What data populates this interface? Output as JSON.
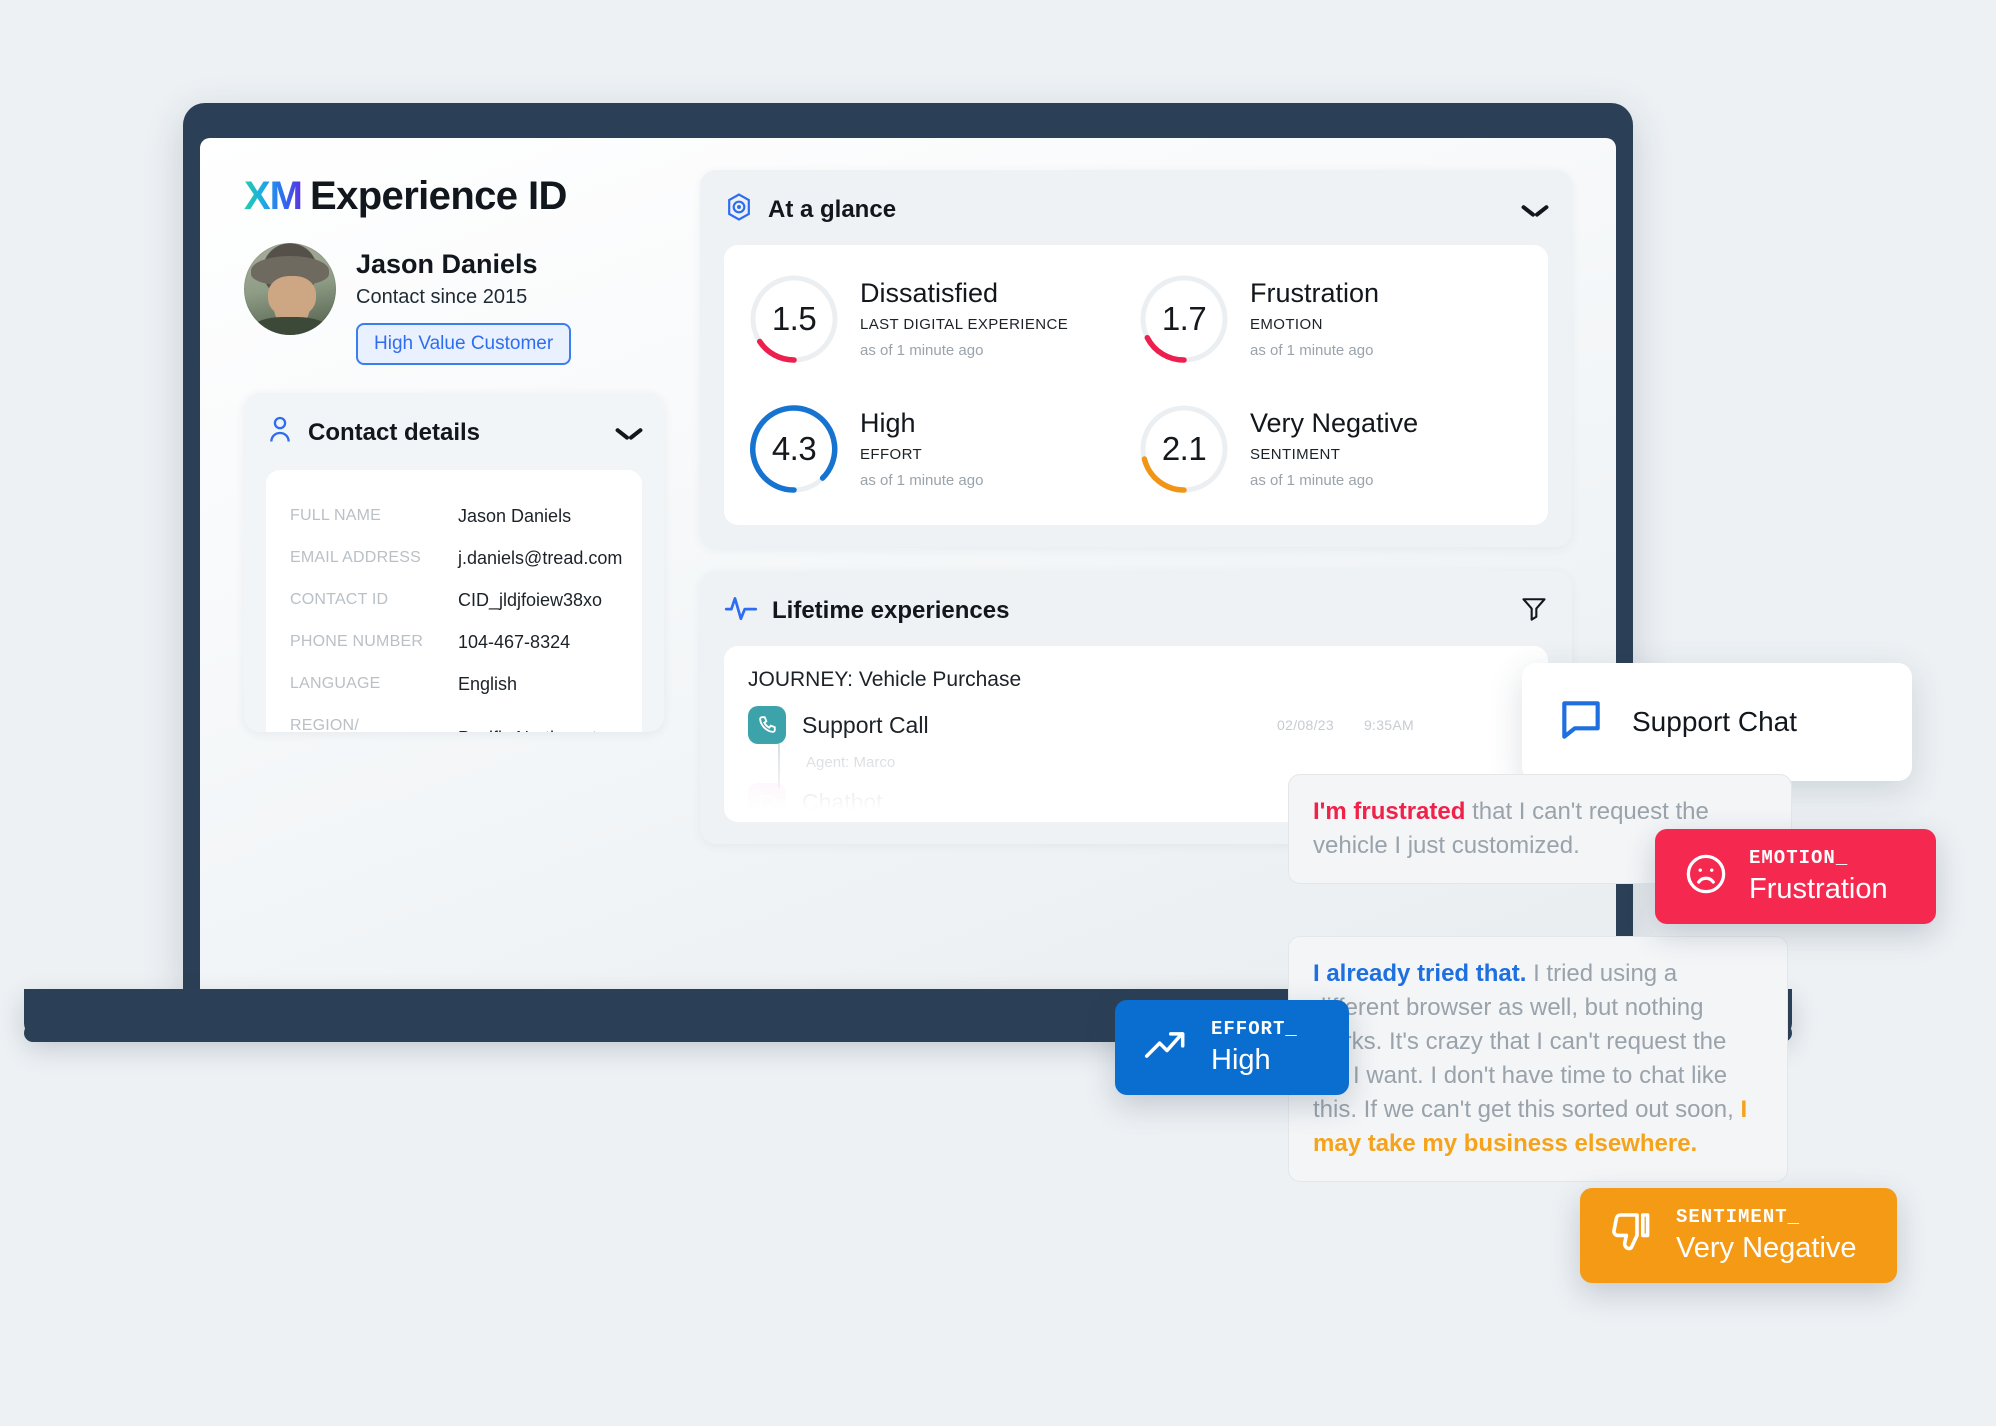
{
  "brand": {
    "mark": "XM",
    "title": "Experience ID"
  },
  "person": {
    "name": "Jason Daniels",
    "since": "Contact since 2015",
    "tag": "High Value Customer",
    "avatar_icon": "user-photo"
  },
  "contact_details": {
    "title": "Contact details",
    "icon": "person-icon",
    "chevron_icon": "chevron-down-icon",
    "rows": [
      {
        "label": "FULL NAME",
        "value": "Jason Daniels"
      },
      {
        "label": "EMAIL ADDRESS",
        "value": "j.daniels@tread.com"
      },
      {
        "label": "CONTACT ID",
        "value": "CID_jldjfoiew38xo"
      },
      {
        "label": "PHONE NUMBER",
        "value": "104-467-8324"
      },
      {
        "label": "LANGUAGE",
        "value": "English"
      },
      {
        "label": "REGION/\nGEOLOCATION",
        "value": "Pacific Northwest, USA"
      }
    ]
  },
  "at_a_glance": {
    "title": "At a glance",
    "icon": "eye-target-icon",
    "chevron_icon": "chevron-down-icon",
    "metrics": [
      {
        "value": "1.5",
        "label": "Dissatisfied",
        "sub": "LAST DIGITAL EXPERIENCE",
        "time": "as of 1 minute ago",
        "color": "#ec1f4e",
        "pct": 30,
        "max": 5
      },
      {
        "value": "1.7",
        "label": "Frustration",
        "sub": "EMOTION",
        "time": "as of 1 minute ago",
        "color": "#ec1f4e",
        "pct": 34,
        "max": 5
      },
      {
        "value": "4.3",
        "label": "High",
        "sub": "EFFORT",
        "time": "as of 1 minute ago",
        "color": "#1673d0",
        "pct": 86,
        "max": 5
      },
      {
        "value": "2.1",
        "label": "Very Negative",
        "sub": "SENTIMENT",
        "time": "as of 1 minute ago",
        "color": "#f09516",
        "pct": 42,
        "max": 5
      }
    ]
  },
  "lifetime_experiences": {
    "title": "Lifetime experiences",
    "icon": "pulse-icon",
    "filter_icon": "filter-funnel-icon",
    "journey": "JOURNEY: Vehicle Purchase",
    "rows": [
      {
        "icon": "phone-icon",
        "name": "Support Call",
        "date": "02/08/23",
        "time": "9:35AM",
        "sub": "Agent: Marco"
      },
      {
        "icon": "chat-window-icon",
        "name": "Chatbot",
        "date": "",
        "time": "",
        "sub": ""
      }
    ]
  },
  "support_chat_card": {
    "icon": "chat-bubble-icon",
    "label": "Support Chat"
  },
  "chat_bubbles": [
    {
      "highlight": "I'm frustrated",
      "highlight_color": "#f0224a",
      "rest": " that I can't request the vehicle I just customized."
    },
    {
      "highlight": "I already tried that.",
      "highlight_color": "#1e6fe0",
      "rest": " I tried using a different browser as well, but nothing works. It's crazy that I can't request the car I want. I don't have time to chat like this. If we can't get this sorted out soon, ",
      "tail_highlight": "I may take my business elsewhere.",
      "tail_color": "#f5a31a"
    }
  ],
  "badges": [
    {
      "key": "EMOTION_",
      "value": "Frustration",
      "icon": "sad-face-icon",
      "color": "#f5294f"
    },
    {
      "key": "EFFORT_",
      "value": "High",
      "icon": "trend-up-icon",
      "color": "#0a6ed1"
    },
    {
      "key": "SENTIMENT_",
      "value": "Very Negative",
      "icon": "thumbs-down-icon",
      "color": "#f59a14"
    }
  ]
}
